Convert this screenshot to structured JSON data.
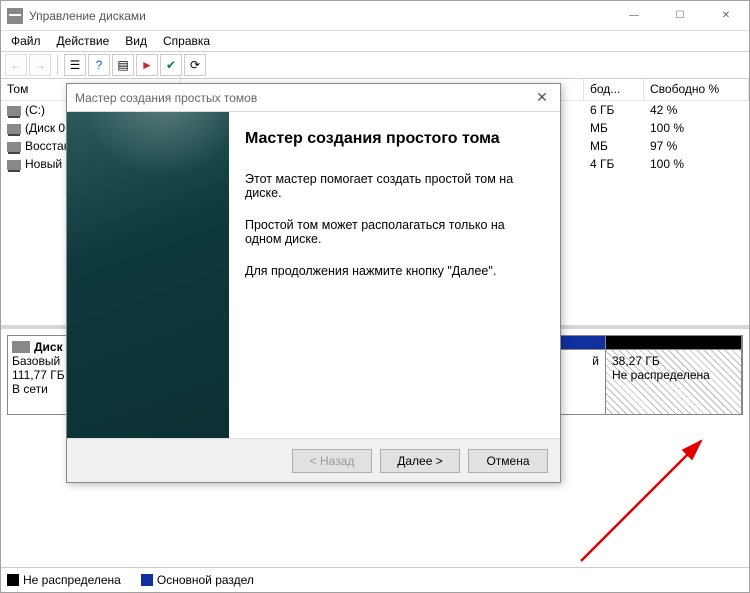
{
  "window": {
    "title": "Управление дисками",
    "sysbuttons": {
      "min": "—",
      "max": "☐",
      "close": "✕"
    }
  },
  "menu": {
    "file": "Файл",
    "action": "Действие",
    "view": "Вид",
    "help": "Справка"
  },
  "toolbar_icons": {
    "back": "←",
    "fwd": "→",
    "up": "?",
    "refresh": "⟳",
    "props": "☰",
    "action": "►",
    "settings": "✔",
    "list": "▤"
  },
  "columns": {
    "volume": "Том",
    "free": "бод...",
    "free_pct": "Свободно %"
  },
  "volumes": [
    {
      "name": "(C:)",
      "free": "6 ГБ",
      "pct": "42 %"
    },
    {
      "name": "(Диск 0",
      "free": "МБ",
      "pct": "100 %"
    },
    {
      "name": "Восстан",
      "free": "МБ",
      "pct": "97 %"
    },
    {
      "name": "Новый ",
      "free": "4 ГБ",
      "pct": "100 %"
    }
  ],
  "disk_label": {
    "name": "Диск 0",
    "type": "Базовый",
    "size": "111,77 ГБ",
    "status": "В сети"
  },
  "partitions": {
    "hidden1": {
      "text": ""
    },
    "visible_primary_marker": "й",
    "unalloc": {
      "size": "38,27 ГБ",
      "status": "Не распределена"
    }
  },
  "legend": {
    "unalloc": "Не распределена",
    "primary": "Основной раздел"
  },
  "wizard": {
    "title": "Мастер создания простых томов",
    "heading": "Мастер создания простого тома",
    "line1": "Этот мастер помогает создать простой том на диске.",
    "line2": "Простой том может располагаться только на одном диске.",
    "line3": "Для продолжения нажмите кнопку \"Далее\".",
    "back": "< Назад",
    "next": "Далее >",
    "cancel": "Отмена"
  }
}
